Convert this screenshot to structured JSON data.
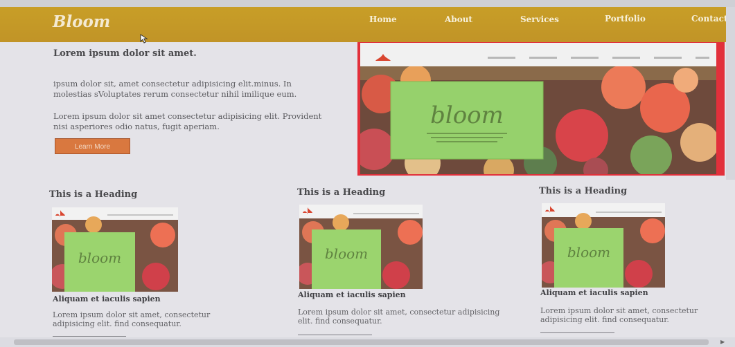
{
  "navbar": {
    "logo": "Bloom",
    "items": [
      "Home",
      "About",
      "Services",
      "Portfolio",
      "Contact"
    ],
    "color": "#c49a27"
  },
  "hero": {
    "title": "Lorem ipsum dolor sit amet.",
    "paragraph1": "ipsum dolor sit, amet consectetur adipisicing elit.minus. In molestias sVoluptates rerum consectetur nihil imilique eum.",
    "paragraph2": "Lorem ipsum dolor sit amet consectetur adipisicing elit. Provident nisi asperiores odio natus, fugit aperiam.",
    "button": "Learn More",
    "accent": "#e2303b",
    "image_text": "bloom"
  },
  "cards": [
    {
      "heading": "This is a Heading",
      "image_text": "bloom",
      "subheading": "Aliquam et iaculis sapien",
      "text": "Lorem ipsum dolor sit amet, consectetur adipisicing elit. find consequatur."
    },
    {
      "heading": "This is a Heading",
      "image_text": "bloom",
      "subheading": "Aliquam et iaculis sapien",
      "text": "Lorem ipsum dolor sit amet, consectetur adipisicing elit. find consequatur."
    },
    {
      "heading": "This is a Heading",
      "image_text": "bloom",
      "subheading": "Aliquam et iaculis sapien",
      "text": "Lorem ipsum dolor sit amet, consectetur adipisicing elit. find consequatur."
    }
  ]
}
